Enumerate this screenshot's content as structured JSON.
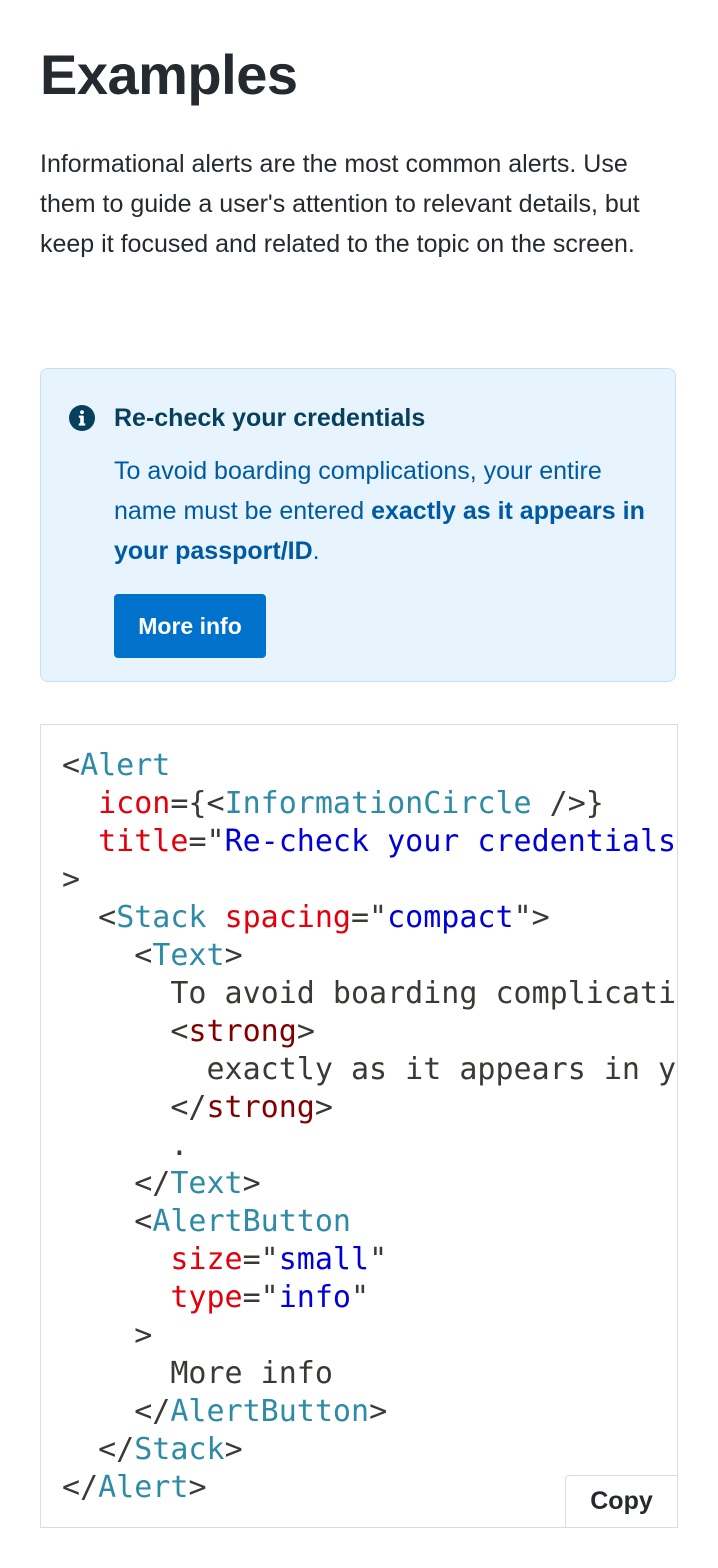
{
  "heading": "Examples",
  "intro": "Informational alerts are the most common alerts. Use them to guide a user's attention to relevant details, but keep it focused and related to the topic on the screen.",
  "alert": {
    "icon": "information-circle-icon",
    "title": "Re-check your credentials",
    "body_prefix": "To avoid boarding complications, your entire name must be entered ",
    "body_strong": "exactly as it appears in your passport/ID",
    "body_suffix": ".",
    "button_label": "More info",
    "colors": {
      "background": "#e8f4fd",
      "border": "#c2e1f8",
      "title": "#07405c",
      "text": "#005aa3",
      "button": "#0172cb"
    }
  },
  "code": {
    "line1_tag": "Alert",
    "line2_attr": "icon",
    "line2_component": "InformationCircle",
    "line3_attr": "title",
    "line3_value": "Re-check your credentials",
    "line5_tag": "Stack",
    "line5_attr": "spacing",
    "line5_value": "compact",
    "line6_tag": "Text",
    "line7_text": "To avoid boarding complications, your entire name must be entered",
    "line8_tag": "strong",
    "line9_text": "exactly as it appears in your passport/ID",
    "line10_tag": "strong",
    "line11_text": ".",
    "line12_tag": "Text",
    "line13_tag": "AlertButton",
    "line14_attr": "size",
    "line14_value": "small",
    "line15_attr": "type",
    "line15_value": "info",
    "line17_text": "More info",
    "line18_tag": "AlertButton",
    "line19_tag": "Stack",
    "line20_tag": "Alert",
    "colors": {
      "tag": "#2e8ba5",
      "attribute": "#e3000b",
      "string": "#0000d8",
      "strong_tag": "#800000"
    }
  },
  "copy_label": "Copy"
}
